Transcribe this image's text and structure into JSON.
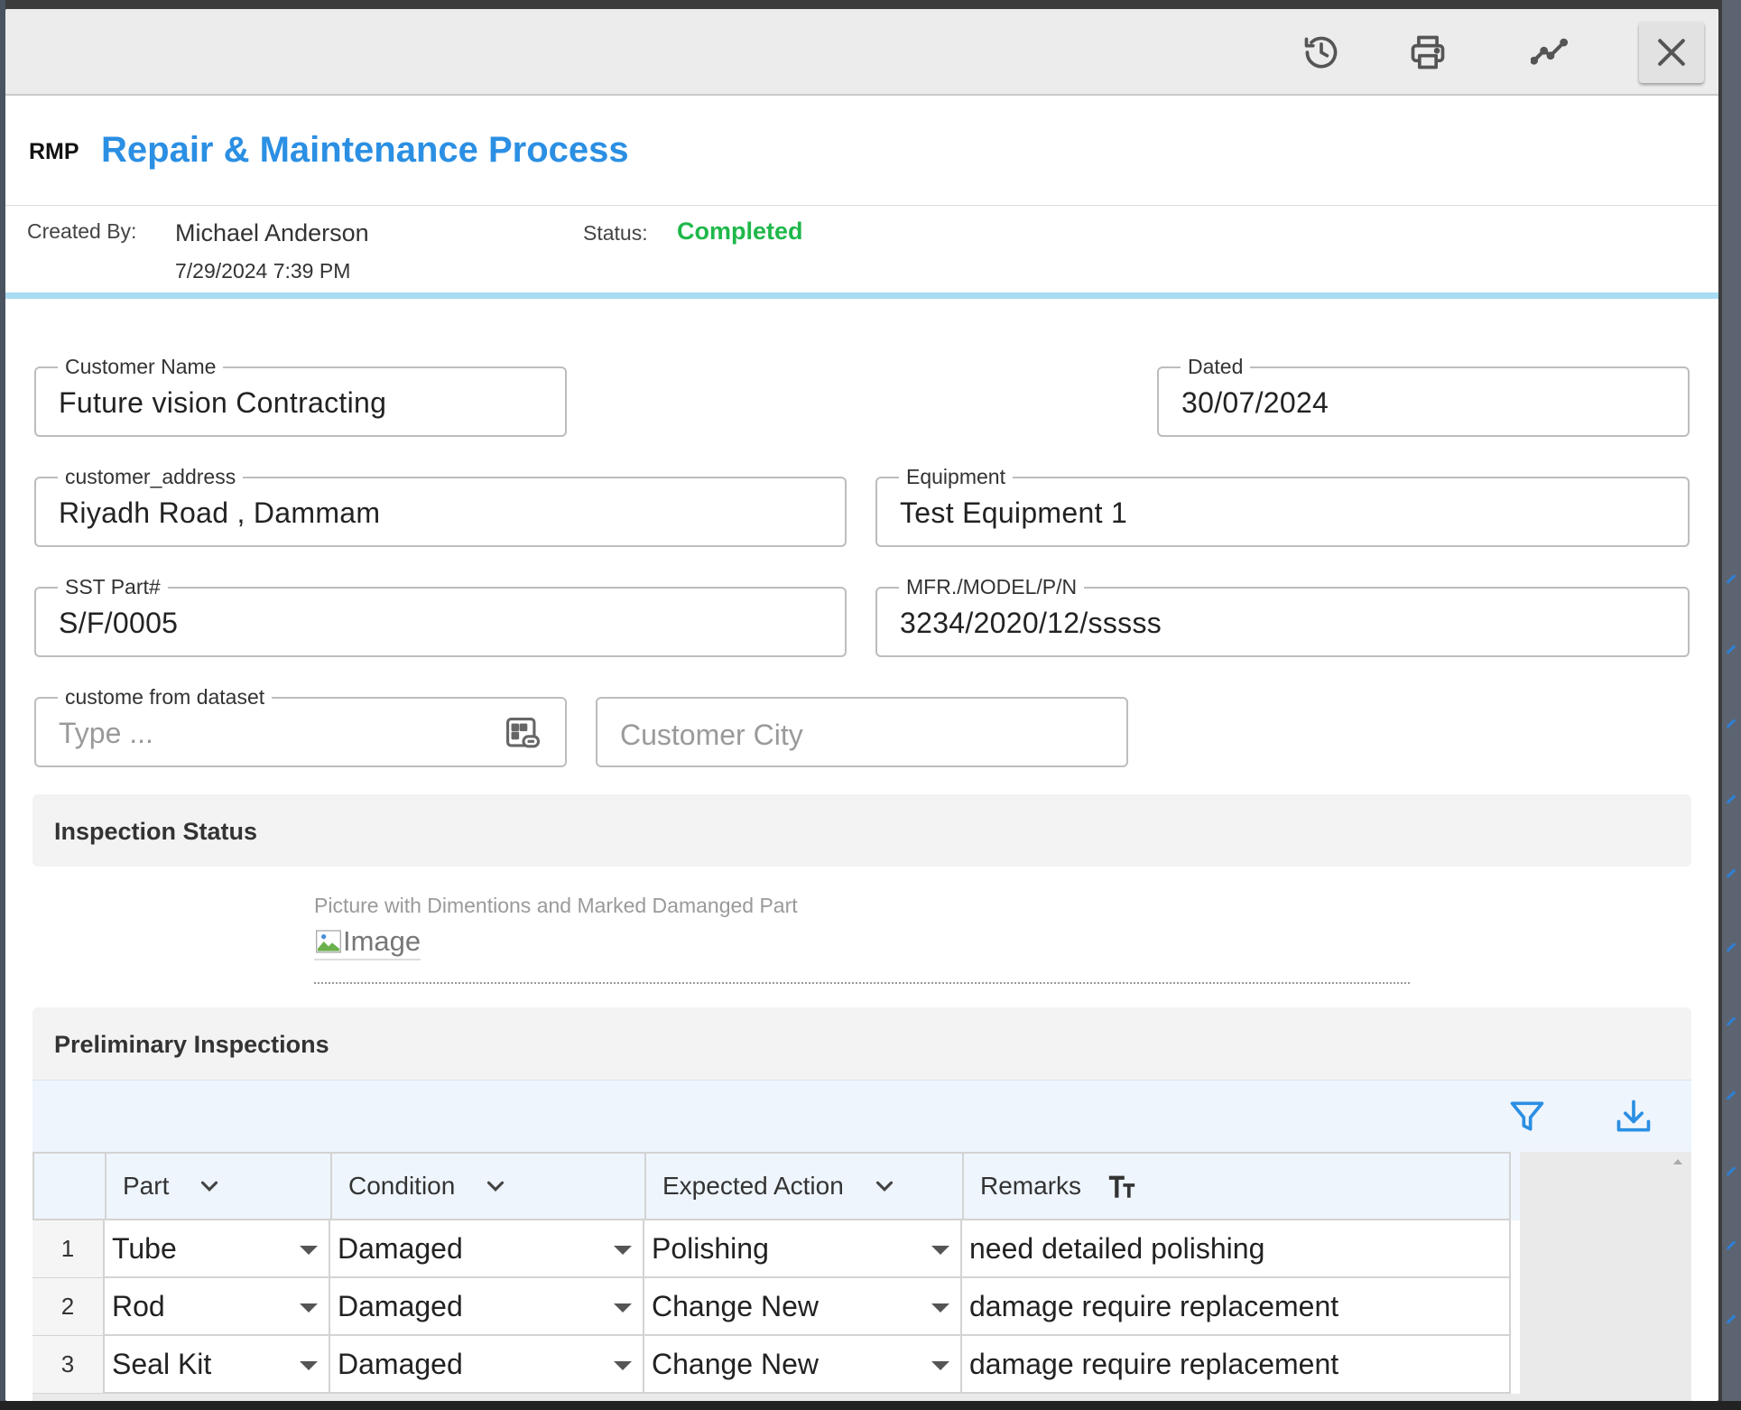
{
  "toolbar": {
    "buttons": [
      {
        "name": "history-icon"
      },
      {
        "name": "print-icon"
      },
      {
        "name": "trend-icon"
      },
      {
        "name": "close-icon"
      }
    ]
  },
  "header": {
    "prefix": "RMP",
    "title": "Repair & Maintenance Process"
  },
  "meta": {
    "created_by_label": "Created By:",
    "created_by_name": "Michael Anderson",
    "created_at": "7/29/2024 7:39 PM",
    "status_label": "Status:",
    "status_value": "Completed",
    "status_color": "#1fb84a"
  },
  "form": {
    "customer_name": {
      "label": "Customer Name",
      "value": "Future vision Contracting"
    },
    "dated": {
      "label": "Dated",
      "value": "30/07/2024"
    },
    "customer_address": {
      "label": "customer_address",
      "value": "Riyadh Road , Dammam"
    },
    "equipment": {
      "label": "Equipment",
      "value": "Test Equipment 1"
    },
    "sst_part": {
      "label": "SST Part#",
      "value": "S/F/0005"
    },
    "mfr_model": {
      "label": "MFR./MODEL/P/N",
      "value": "3234/2020/12/sssss"
    },
    "custome_dataset": {
      "label": "custome from dataset",
      "placeholder": "Type ..."
    },
    "customer_city": {
      "placeholder": "Customer City"
    }
  },
  "inspection_status": {
    "title": "Inspection Status",
    "picture_label": "Picture with Dimentions and Marked Damanged Part",
    "image_alt": "Image"
  },
  "preliminary": {
    "title": "Preliminary Inspections",
    "columns": [
      {
        "label": "Part",
        "icon": "chevron-down-icon"
      },
      {
        "label": "Condition",
        "icon": "chevron-down-icon"
      },
      {
        "label": "Expected Action",
        "icon": "chevron-down-icon"
      },
      {
        "label": "Remarks",
        "icon": "text-size-icon"
      }
    ],
    "rows": [
      {
        "num": "1",
        "part": "Tube",
        "condition": "Damaged",
        "action": "Polishing",
        "remarks": "need detailed polishing"
      },
      {
        "num": "2",
        "part": "Rod",
        "condition": "Damaged",
        "action": "Change New",
        "remarks": "damage require replacement"
      },
      {
        "num": "3",
        "part": "Seal Kit",
        "condition": "Damaged",
        "action": "Change New",
        "remarks": "damage require replacement"
      }
    ]
  },
  "colors": {
    "accent": "#2b8fe3",
    "divider": "#a9dbf3"
  }
}
